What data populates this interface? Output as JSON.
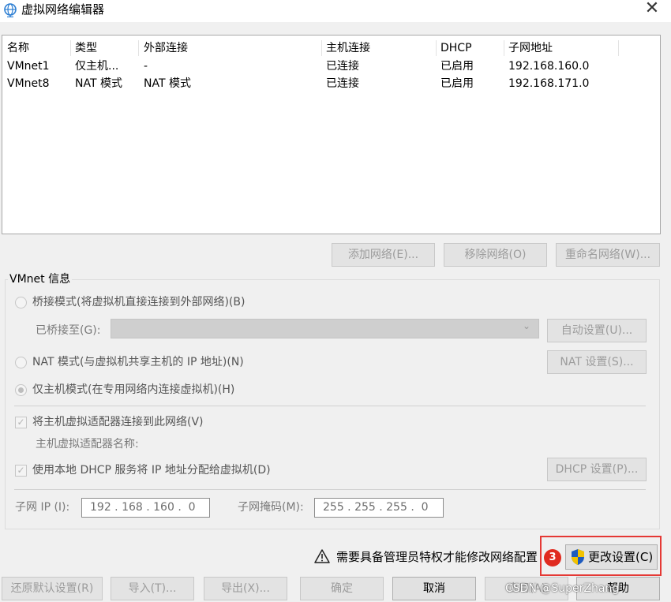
{
  "window": {
    "title": "虚拟网络编辑器"
  },
  "table": {
    "headers": [
      "名称",
      "类型",
      "外部连接",
      "主机连接",
      "DHCP",
      "子网地址"
    ],
    "rows": [
      [
        "VMnet1",
        "仅主机...",
        "-",
        "已连接",
        "已启用",
        "192.168.160.0"
      ],
      [
        "VMnet8",
        "NAT 模式",
        "NAT 模式",
        "已连接",
        "已启用",
        "192.168.171.0"
      ]
    ]
  },
  "list_buttons": {
    "add": "添加网络(E)...",
    "remove": "移除网络(O)",
    "rename": "重命名网络(W)..."
  },
  "info": {
    "group_label": "VMnet 信息",
    "bridge_mode": "桥接模式(将虚拟机直接连接到外部网络)(B)",
    "bridged_to": "已桥接至(G):",
    "auto_settings": "自动设置(U)...",
    "nat_mode": "NAT 模式(与虚拟机共享主机的 IP 地址)(N)",
    "nat_settings": "NAT 设置(S)...",
    "host_only_mode": "仅主机模式(在专用网络内连接虚拟机)(H)",
    "connect_adapter": "将主机虚拟适配器连接到此网络(V)",
    "adapter_name_label": "主机虚拟适配器名称:",
    "use_dhcp": "使用本地 DHCP 服务将 IP 地址分配给虚拟机(D)",
    "dhcp_settings": "DHCP 设置(P)...",
    "subnet_ip_label": "子网 IP (I):",
    "subnet_ip": "192 . 168 . 160 .  0",
    "subnet_mask_label": "子网掩码(M):",
    "subnet_mask": "255 . 255 . 255 .  0"
  },
  "warning": {
    "text": "需要具备管理员特权才能修改网络配置",
    "step_badge": "3",
    "change_button": "更改设置(C)"
  },
  "bottom_buttons": {
    "restore": "还原默认设置(R)",
    "import": "导入(T)...",
    "export": "导出(X)...",
    "ok": "确定",
    "cancel": "取消",
    "apply": "应用(A)",
    "help": "帮助"
  },
  "watermark": "CSDN @SuperZhang",
  "colors": {
    "highlight": "#e53935",
    "badge": "#e02b20",
    "shield_blue": "#1e5bbf",
    "shield_yellow": "#f2c200"
  }
}
